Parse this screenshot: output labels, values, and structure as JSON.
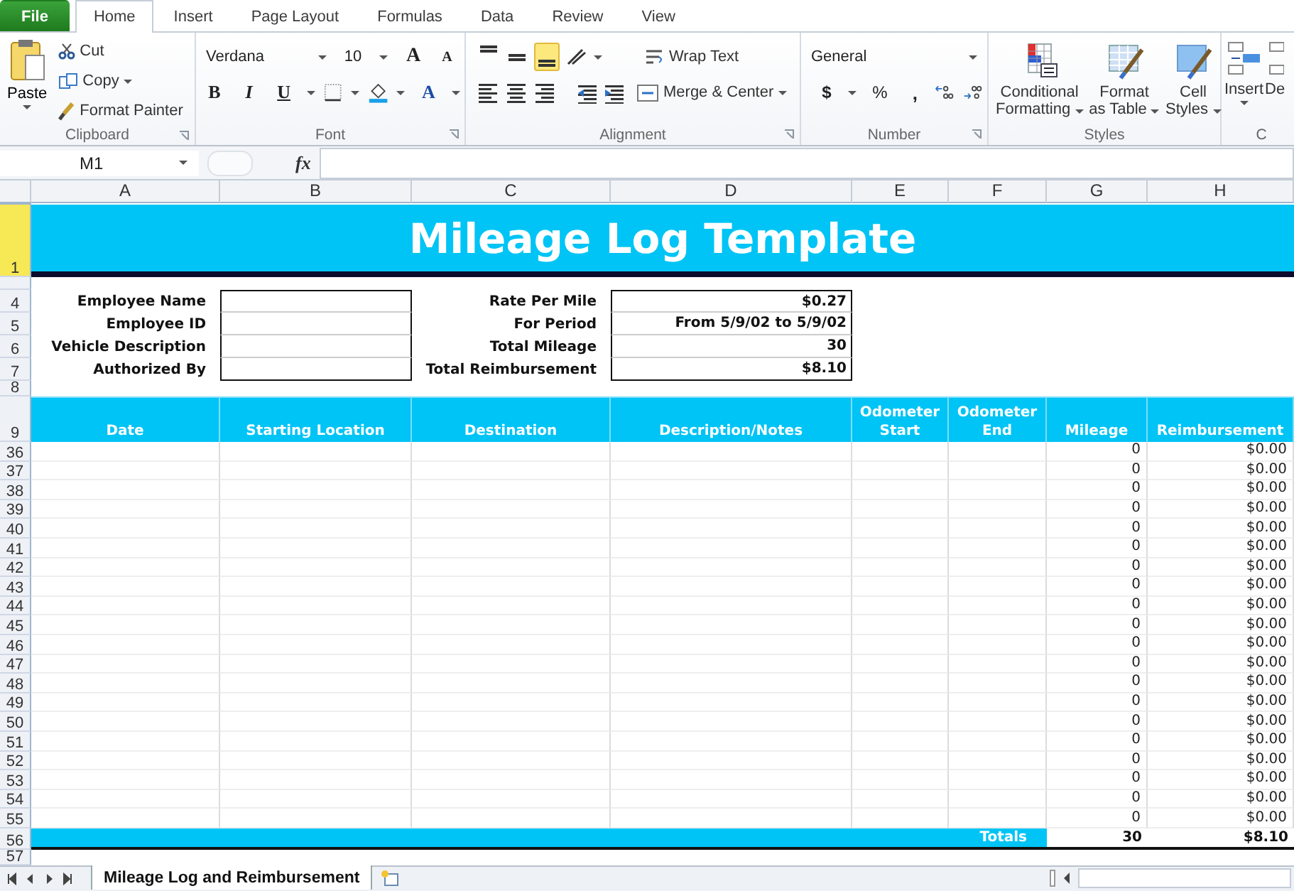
{
  "ribbon_tabs": [
    {
      "label": "File",
      "kind": "file",
      "selected": false
    },
    {
      "label": "Home",
      "kind": "tab",
      "selected": true
    },
    {
      "label": "Insert",
      "kind": "tab",
      "selected": false
    },
    {
      "label": "Page Layout",
      "kind": "tab",
      "selected": false
    },
    {
      "label": "Formulas",
      "kind": "tab",
      "selected": false
    },
    {
      "label": "Data",
      "kind": "tab",
      "selected": false
    },
    {
      "label": "Review",
      "kind": "tab",
      "selected": false
    },
    {
      "label": "View",
      "kind": "tab",
      "selected": false
    }
  ],
  "clipboard": {
    "title": "Clipboard",
    "paste": "Paste",
    "cut": "Cut",
    "copy": "Copy",
    "format_painter": "Format Painter"
  },
  "font": {
    "title": "Font",
    "family": "Verdana",
    "size": "10",
    "grow": "A",
    "shrink": "A",
    "bold": "B",
    "italic": "I",
    "underline": "U",
    "font_color_letter": "A"
  },
  "alignment": {
    "title": "Alignment",
    "vertical": [
      {
        "kind": "top",
        "selected": false
      },
      {
        "kind": "middle",
        "selected": false
      },
      {
        "kind": "bottom",
        "selected": true
      }
    ],
    "wrap_text": "Wrap Text",
    "merge_center": "Merge & Center"
  },
  "number": {
    "title": "Number",
    "format": "General",
    "currency": "$",
    "percent": "%",
    "comma": ","
  },
  "styles": {
    "title": "Styles",
    "buttons": [
      {
        "kind": "conditional",
        "lines": [
          "Conditional",
          "Formatting"
        ]
      },
      {
        "kind": "table",
        "lines": [
          "Format",
          "as Table"
        ]
      },
      {
        "kind": "cell",
        "lines": [
          "Cell",
          "Styles"
        ]
      }
    ]
  },
  "cells": {
    "title": "C",
    "insert": "Insert",
    "delete": "De"
  },
  "formula_bar": {
    "name_box": "M1",
    "fx": "fx"
  },
  "columns": [
    "A",
    "B",
    "C",
    "D",
    "E",
    "F",
    "G",
    "H"
  ],
  "title_row": {
    "row": "1",
    "selected": true,
    "text": "Mileage Log Template"
  },
  "info_rows": [
    {
      "row": "4",
      "label": "Employee Name",
      "summary_label": "Rate Per Mile",
      "summary_value": "$0.27"
    },
    {
      "row": "5",
      "label": "Employee ID",
      "summary_label": "For Period",
      "summary_value": "From 5/9/02 to 5/9/02"
    },
    {
      "row": "6",
      "label": "Vehicle Description",
      "summary_label": "Total Mileage",
      "summary_value": "30"
    },
    {
      "row": "7",
      "label": "Authorized By",
      "summary_label": "Total Reimbursement",
      "summary_value": "$8.10"
    }
  ],
  "blank_row": "8",
  "log_header": {
    "row": "9",
    "columns": [
      "Date",
      "Starting Location",
      "Destination",
      "Description/Notes",
      "Odometer Start",
      "Odometer End",
      "Mileage",
      "Reimbursement"
    ]
  },
  "log_rows": [
    {
      "row": "36",
      "mileage": "0",
      "reimbursement": "$0.00"
    },
    {
      "row": "37",
      "mileage": "0",
      "reimbursement": "$0.00"
    },
    {
      "row": "38",
      "mileage": "0",
      "reimbursement": "$0.00"
    },
    {
      "row": "39",
      "mileage": "0",
      "reimbursement": "$0.00"
    },
    {
      "row": "40",
      "mileage": "0",
      "reimbursement": "$0.00"
    },
    {
      "row": "41",
      "mileage": "0",
      "reimbursement": "$0.00"
    },
    {
      "row": "42",
      "mileage": "0",
      "reimbursement": "$0.00"
    },
    {
      "row": "43",
      "mileage": "0",
      "reimbursement": "$0.00"
    },
    {
      "row": "44",
      "mileage": "0",
      "reimbursement": "$0.00"
    },
    {
      "row": "45",
      "mileage": "0",
      "reimbursement": "$0.00"
    },
    {
      "row": "46",
      "mileage": "0",
      "reimbursement": "$0.00"
    },
    {
      "row": "47",
      "mileage": "0",
      "reimbursement": "$0.00"
    },
    {
      "row": "48",
      "mileage": "0",
      "reimbursement": "$0.00"
    },
    {
      "row": "49",
      "mileage": "0",
      "reimbursement": "$0.00"
    },
    {
      "row": "50",
      "mileage": "0",
      "reimbursement": "$0.00"
    },
    {
      "row": "51",
      "mileage": "0",
      "reimbursement": "$0.00"
    },
    {
      "row": "52",
      "mileage": "0",
      "reimbursement": "$0.00"
    },
    {
      "row": "53",
      "mileage": "0",
      "reimbursement": "$0.00"
    },
    {
      "row": "54",
      "mileage": "0",
      "reimbursement": "$0.00"
    },
    {
      "row": "55",
      "mileage": "0",
      "reimbursement": "$0.00"
    }
  ],
  "totals": {
    "row": "56",
    "label": "Totals",
    "mileage": "30",
    "reimbursement": "$8.10"
  },
  "last_row": "57",
  "sheet_tabs": [
    {
      "label": "Mileage Log and Reimbursement",
      "selected": true
    }
  ]
}
